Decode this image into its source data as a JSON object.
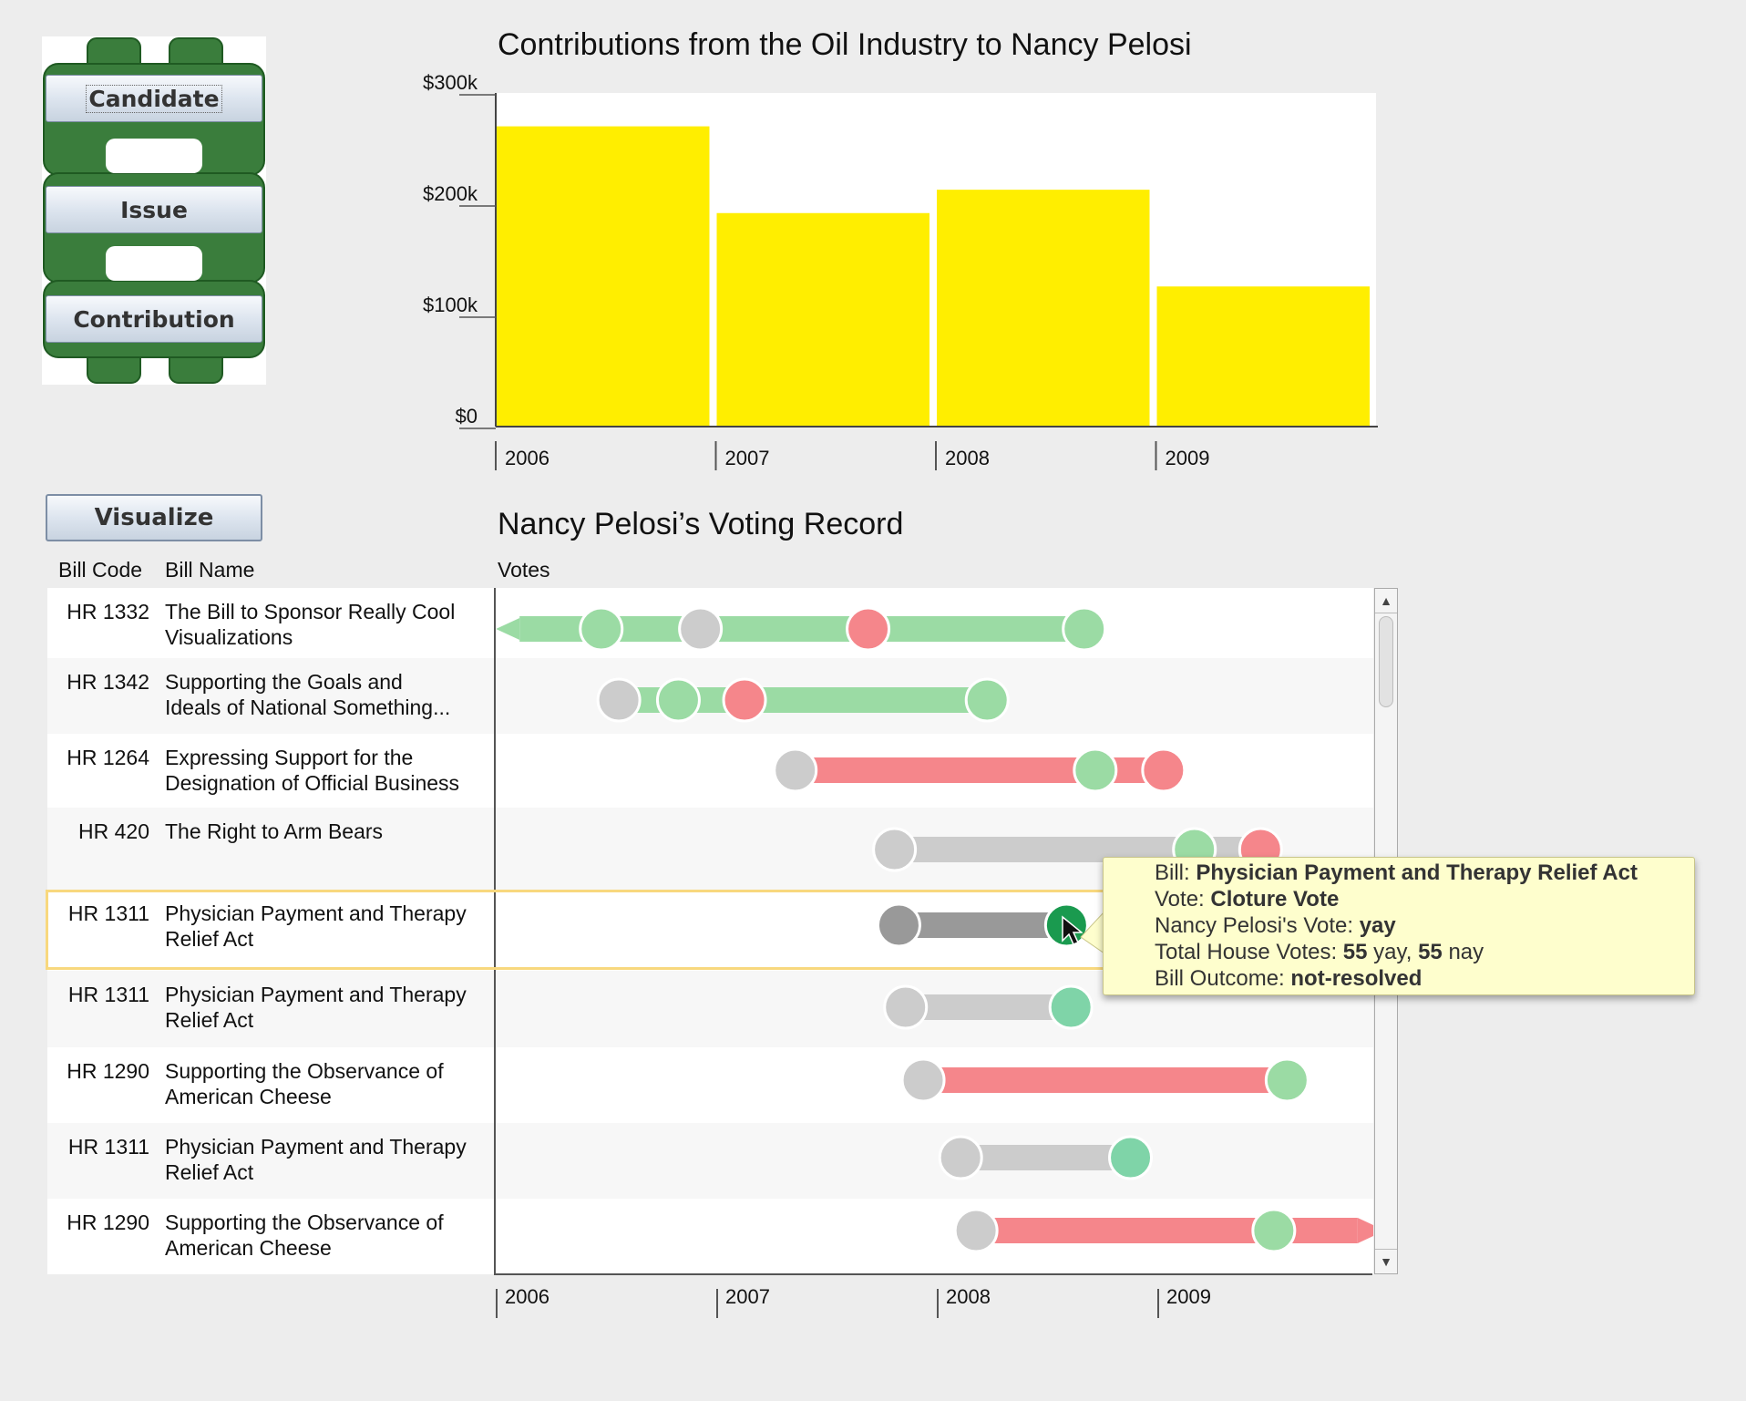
{
  "nav": {
    "candidate_label": "Candidate",
    "issue_label": "Issue",
    "contribution_label": "Contribution",
    "visualize_label": "Visualize"
  },
  "contributions": {
    "title": "Contributions from the Oil Industry to Nancy Pelosi",
    "bar_color": "#ffee00"
  },
  "chart_data": {
    "type": "bar",
    "title": "Contributions from the Oil Industry to Nancy Pelosi",
    "categories": [
      "2006",
      "2007",
      "2008",
      "2009"
    ],
    "values": [
      270000,
      192000,
      213000,
      126000
    ],
    "y_ticks": [
      {
        "value": 0,
        "label": "$0"
      },
      {
        "value": 100000,
        "label": "$100k"
      },
      {
        "value": 200000,
        "label": "$200k"
      },
      {
        "value": 300000,
        "label": "$300k"
      }
    ],
    "ylim": [
      0,
      300000
    ],
    "xlabel": "",
    "ylabel": "",
    "grid": false
  },
  "voting": {
    "title": "Nancy Pelosi’s Voting Record",
    "col_bill_code": "Bill Code",
    "col_bill_name": "Bill Name",
    "col_votes": "Votes",
    "timeline_ticks": [
      "2006",
      "2007",
      "2008",
      "2009"
    ],
    "colors": {
      "yay": "#9bdba4",
      "nay": "#f5868b",
      "none": "#cccccc",
      "selected_yay": "#1a9a4f",
      "selected_none": "#999999",
      "resolved_yay": "#7fd4a8"
    },
    "rows": [
      {
        "code": "HR 1332",
        "name_line1": "The Bill to Sponsor Really Cool",
        "name_line2": "Visualizations",
        "bar": "yay",
        "start": 2006.1,
        "end": 2008.65,
        "arrow_left": true,
        "arrow_right": false,
        "votes": [
          {
            "t": 2006.47,
            "v": "yay"
          },
          {
            "t": 2006.92,
            "v": "none"
          },
          {
            "t": 2007.68,
            "v": "nay"
          },
          {
            "t": 2008.66,
            "v": "yay"
          }
        ]
      },
      {
        "code": "HR 1342",
        "name_line1": "Supporting the Goals and",
        "name_line2": "Ideals of National Something...",
        "bar": "yay",
        "start": 2006.55,
        "end": 2008.2,
        "arrow_left": false,
        "arrow_right": false,
        "votes": [
          {
            "t": 2006.55,
            "v": "none"
          },
          {
            "t": 2006.82,
            "v": "yay"
          },
          {
            "t": 2007.12,
            "v": "nay"
          },
          {
            "t": 2008.22,
            "v": "yay"
          }
        ]
      },
      {
        "code": "HR 1264",
        "name_line1": "Expressing Support for the",
        "name_line2": "Designation of Official Business",
        "bar": "nay",
        "start": 2007.35,
        "end": 2009.0,
        "arrow_left": false,
        "arrow_right": false,
        "votes": [
          {
            "t": 2007.35,
            "v": "none"
          },
          {
            "t": 2008.71,
            "v": "yay"
          },
          {
            "t": 2009.02,
            "v": "nay"
          }
        ]
      },
      {
        "code": "HR 420",
        "name_line1": "The Right to Arm Bears",
        "name_line2": "",
        "bar": "none",
        "start": 2007.8,
        "end": 2009.45,
        "arrow_left": false,
        "arrow_right": false,
        "votes": [
          {
            "t": 2007.8,
            "v": "none"
          },
          {
            "t": 2009.16,
            "v": "yay"
          },
          {
            "t": 2009.46,
            "v": "nay"
          }
        ]
      },
      {
        "code": "HR 1311",
        "name_line1": "Physician Payment and Therapy",
        "name_line2": "Relief Act",
        "bar": "selected_none",
        "start": 2007.82,
        "end": 2008.58,
        "arrow_left": false,
        "arrow_right": false,
        "votes": [
          {
            "t": 2007.82,
            "v": "selected_none"
          },
          {
            "t": 2008.58,
            "v": "selected_yay"
          }
        ]
      },
      {
        "code": "HR 1311",
        "name_line1": "Physician Payment and Therapy",
        "name_line2": "Relief Act",
        "bar": "none",
        "start": 2007.85,
        "end": 2008.6,
        "arrow_left": false,
        "arrow_right": false,
        "votes": [
          {
            "t": 2007.85,
            "v": "none"
          },
          {
            "t": 2008.6,
            "v": "resolved_yay"
          }
        ]
      },
      {
        "code": "HR 1290",
        "name_line1": "Supporting the Observance of",
        "name_line2": "American Cheese",
        "bar": "nay",
        "start": 2007.93,
        "end": 2009.58,
        "arrow_left": false,
        "arrow_right": false,
        "votes": [
          {
            "t": 2007.93,
            "v": "none"
          },
          {
            "t": 2009.58,
            "v": "yay"
          }
        ]
      },
      {
        "code": "HR 1311",
        "name_line1": "Physician Payment and Therapy",
        "name_line2": "Relief Act",
        "bar": "none",
        "start": 2008.1,
        "end": 2008.86,
        "arrow_left": false,
        "arrow_right": false,
        "votes": [
          {
            "t": 2008.1,
            "v": "none"
          },
          {
            "t": 2008.87,
            "v": "resolved_yay"
          }
        ]
      },
      {
        "code": "HR 1290",
        "name_line1": "Supporting the Observance of",
        "name_line2": "American Cheese",
        "bar": "nay",
        "start": 2008.17,
        "end": 2009.9,
        "arrow_left": false,
        "arrow_right": true,
        "votes": [
          {
            "t": 2008.17,
            "v": "none"
          },
          {
            "t": 2009.52,
            "v": "yay"
          }
        ]
      }
    ]
  },
  "tooltip": {
    "bill_label": "Bill: ",
    "bill_value": "Physician Payment and Therapy Relief Act",
    "vote_label": "Vote: ",
    "vote_value": "Cloture Vote",
    "member_vote_label": "Nancy Pelosi's Vote: ",
    "member_vote_value": "yay",
    "total_label": "Total House Votes: ",
    "total_yay": "55",
    "total_yay_suffix": " yay, ",
    "total_nay": "55",
    "total_nay_suffix": " nay",
    "outcome_label": "Bill Outcome: ",
    "outcome_value": "not-resolved"
  }
}
